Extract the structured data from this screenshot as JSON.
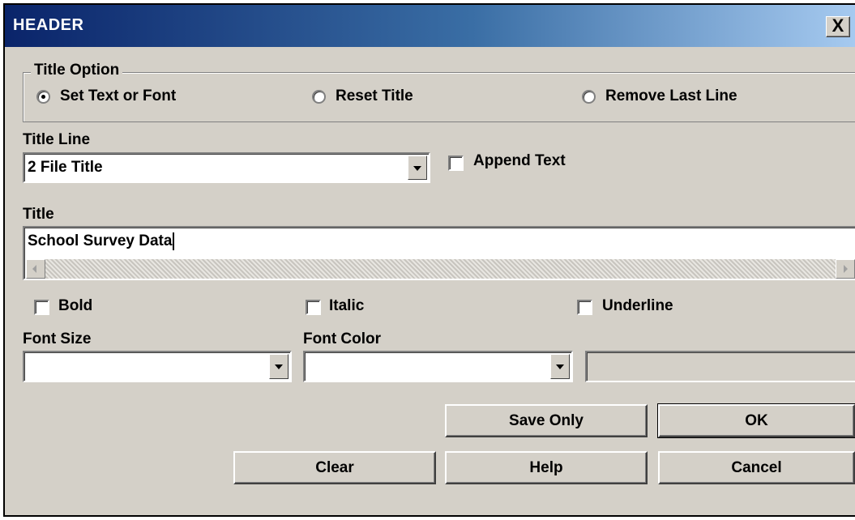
{
  "window": {
    "title": "HEADER",
    "close_glyph": "X"
  },
  "title_option": {
    "label": "Title Option",
    "options": [
      {
        "label": "Set Text or Font",
        "selected": true
      },
      {
        "label": "Reset Title",
        "selected": false
      },
      {
        "label": "Remove Last Line",
        "selected": false
      }
    ]
  },
  "title_line": {
    "label": "Title Line",
    "value": "2 File Title"
  },
  "append_text": {
    "label": "Append Text",
    "checked": false
  },
  "title": {
    "label": "Title",
    "value": "School Survey Data"
  },
  "style": {
    "bold": {
      "label": "Bold",
      "checked": false
    },
    "italic": {
      "label": "Italic",
      "checked": false
    },
    "underline": {
      "label": "Underline",
      "checked": false
    }
  },
  "font_size": {
    "label": "Font Size",
    "value": ""
  },
  "font_color": {
    "label": "Font Color",
    "value": ""
  },
  "buttons": {
    "save_only": "Save Only",
    "ok": "OK",
    "clear": "Clear",
    "help": "Help",
    "cancel": "Cancel"
  },
  "colors": {
    "titlebar_start": "#0a246a",
    "titlebar_end": "#a6caf0",
    "face": "#d4d0c8"
  }
}
